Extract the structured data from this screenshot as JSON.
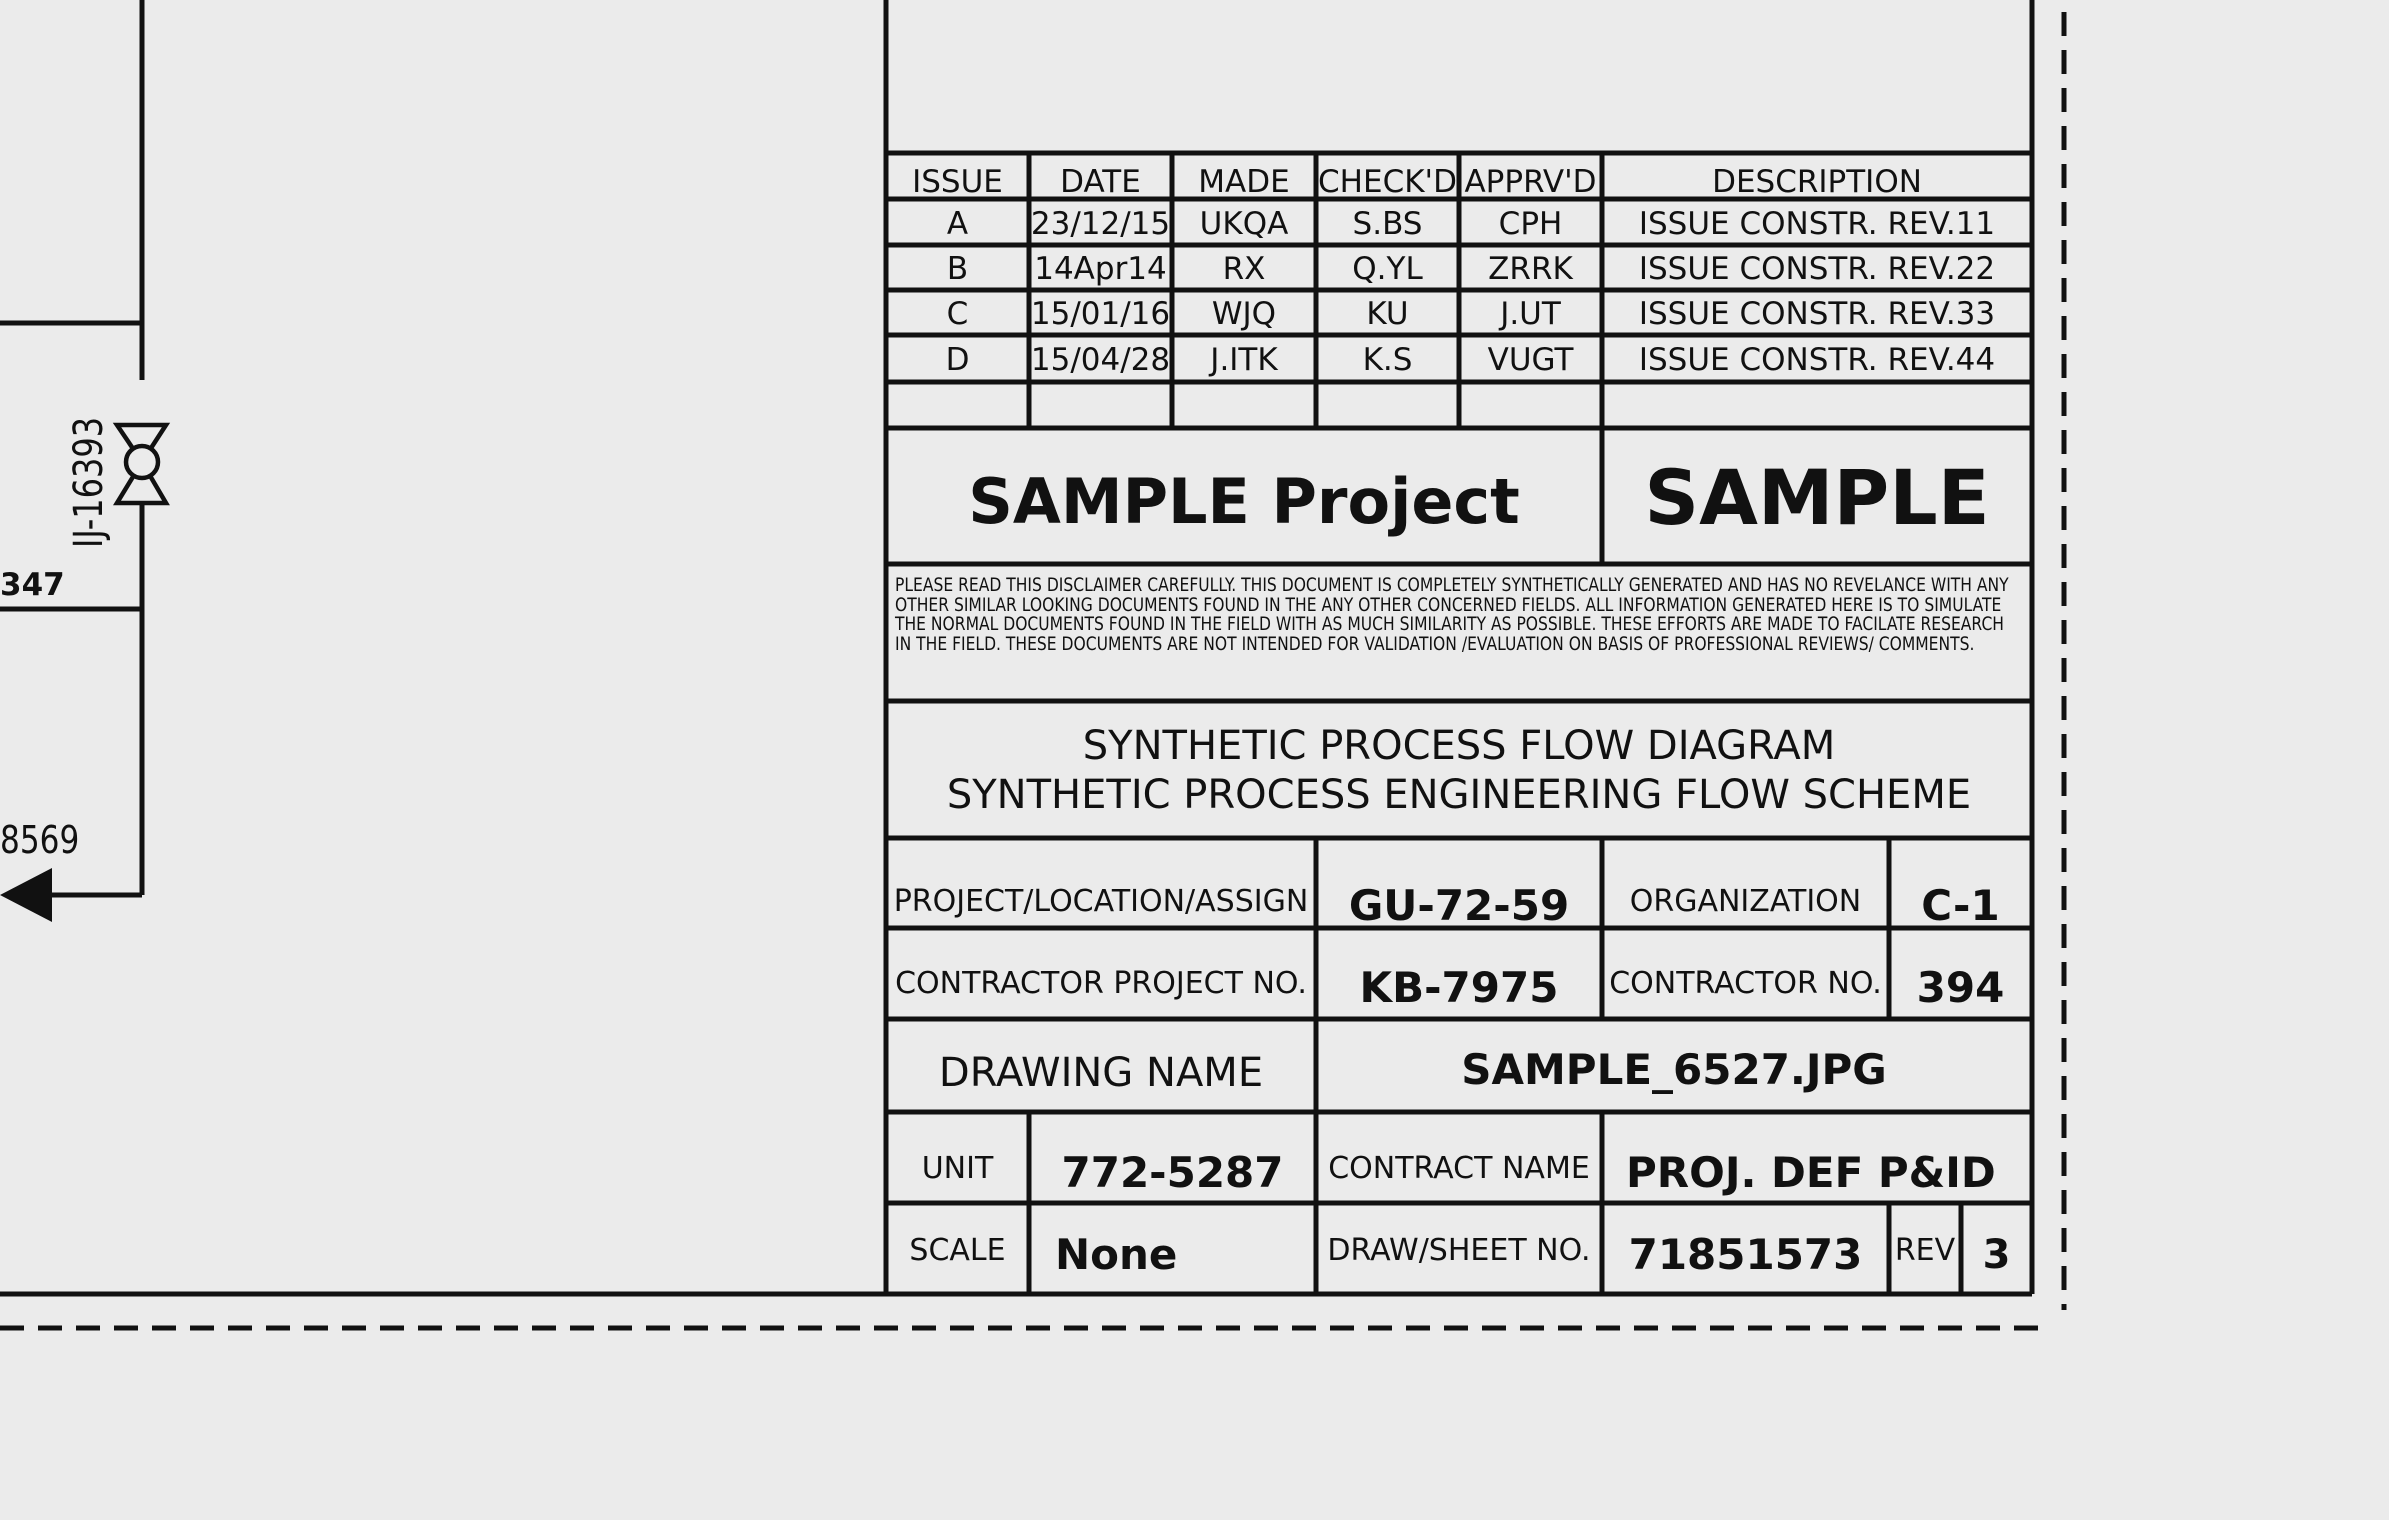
{
  "diagram": {
    "valve_tag": "IJ-16393",
    "line_label_1": "347",
    "line_label_2": "8569"
  },
  "revisions": {
    "headers": [
      "ISSUE",
      "DATE",
      "MADE",
      "CHECK'D",
      "APPRV'D",
      "DESCRIPTION"
    ],
    "rows": [
      [
        "A",
        "23/12/15",
        "UKQA",
        "S.BS",
        "CPH",
        "ISSUE CONSTR. REV.11"
      ],
      [
        "B",
        "14Apr14",
        "RX",
        "Q.YL",
        "ZRRK",
        "ISSUE CONSTR. REV.22"
      ],
      [
        "C",
        "15/01/16",
        "WJQ",
        "KU",
        "J.UT",
        "ISSUE CONSTR. REV.33"
      ],
      [
        "D",
        "15/04/28",
        "J.ITK",
        "K.S",
        "VUGT",
        "ISSUE CONSTR. REV.44"
      ]
    ]
  },
  "project_title": "SAMPLE Project",
  "company": "SAMPLE",
  "disclaimer": "PLEASE READ THIS DISCLAIMER CAREFULLY. THIS DOCUMENT IS COMPLETELY SYNTHETICALLY GENERATED AND HAS NO REVELANCE WITH ANY OTHER SIMILAR LOOKING DOCUMENTS FOUND IN THE ANY OTHER CONCERNED FIELDS. ALL INFORMATION GENERATED HERE IS TO SIMULATE THE NORMAL DOCUMENTS FOUND IN THE FIELD WITH AS MUCH SIMILARITY AS POSSIBLE. THESE EFFORTS ARE MADE TO FACILATE RESEARCH IN THE FIELD. THESE DOCUMENTS ARE NOT INTENDED FOR VALIDATION /EVALUATION ON BASIS OF PROFESSIONAL REVIEWS/ COMMENTS.",
  "drawing_title": {
    "line1": "SYNTHETIC PROCESS FLOW DIAGRAM",
    "line2": "SYNTHETIC PROCESS ENGINEERING FLOW SCHEME"
  },
  "fields": {
    "project_location_label": "PROJECT/LOCATION/ASSIGN",
    "project_location_value": "GU-72-59",
    "organization_label": "ORGANIZATION",
    "organization_value": "C-1",
    "contractor_project_label": "CONTRACTOR PROJECT NO.",
    "contractor_project_value": "KB-7975",
    "contractor_no_label": "CONTRACTOR NO.",
    "contractor_no_value": "394",
    "drawing_name_label": "DRAWING NAME",
    "drawing_name_value": "SAMPLE_6527.JPG",
    "unit_label": "UNIT",
    "unit_value": "772-5287",
    "contract_name_label": "CONTRACT NAME",
    "contract_name_value": "PROJ. DEF P&ID",
    "scale_label": "SCALE",
    "scale_value": "None",
    "sheet_label": "DRAW/SHEET NO.",
    "sheet_value": "71851573",
    "rev_label": "REV",
    "rev_value": "3"
  }
}
